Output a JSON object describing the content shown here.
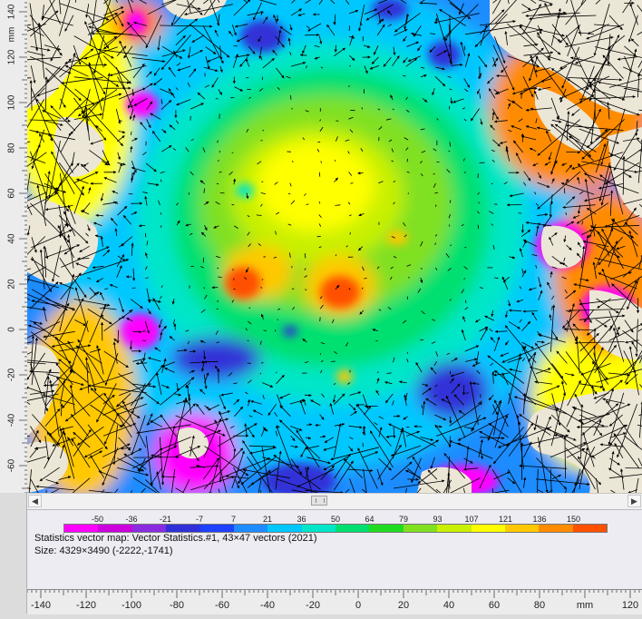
{
  "vertical_ruler": {
    "unit": "mm",
    "labels": [
      {
        "text": "140",
        "value": 140
      },
      {
        "text": "120",
        "value": 120
      },
      {
        "text": "100",
        "value": 100
      },
      {
        "text": "80",
        "value": 80
      },
      {
        "text": "60",
        "value": 60
      },
      {
        "text": "40",
        "value": 40
      },
      {
        "text": "20",
        "value": 20
      },
      {
        "text": "0",
        "value": 0
      },
      {
        "text": "-20",
        "value": -20
      },
      {
        "text": "-40",
        "value": -40
      },
      {
        "text": "-60",
        "value": -60
      }
    ]
  },
  "horizontal_ruler": {
    "unit": "mm",
    "labels": [
      {
        "text": "-140",
        "value": -140
      },
      {
        "text": "-120",
        "value": -120
      },
      {
        "text": "-100",
        "value": -100
      },
      {
        "text": "-80",
        "value": -80
      },
      {
        "text": "-60",
        "value": -60
      },
      {
        "text": "-40",
        "value": -40
      },
      {
        "text": "-20",
        "value": -20
      },
      {
        "text": "0",
        "value": 0
      },
      {
        "text": "20",
        "value": 20
      },
      {
        "text": "40",
        "value": 40
      },
      {
        "text": "60",
        "value": 60
      },
      {
        "text": "80",
        "value": 80
      },
      {
        "text": "120",
        "value": 120
      }
    ]
  },
  "legend": {
    "values": [
      "-50",
      "-36",
      "-21",
      "-7",
      "7",
      "21",
      "36",
      "50",
      "64",
      "79",
      "93",
      "107",
      "121",
      "136",
      "150"
    ],
    "colors": [
      "#ff00ff",
      "#cc00dd",
      "#8a2be2",
      "#3030d8",
      "#1e40ff",
      "#1e8cff",
      "#00c8ff",
      "#00e6c8",
      "#00e070",
      "#20dc20",
      "#80e020",
      "#c8f000",
      "#ffff00",
      "#ffc800",
      "#ff8c00",
      "#ff5000"
    ]
  },
  "info": {
    "line1": "Statistics vector map: Vector Statistics.#1, 43×47 vectors (2021)",
    "line2": "Size: 4329×3490 (-2222,-1741)"
  },
  "scrollbar": {
    "left_icon": "arrow-left-icon",
    "right_icon": "arrow-right-icon"
  },
  "plot": {
    "background_color": "#ece6d6",
    "vector_color": "#000000"
  }
}
